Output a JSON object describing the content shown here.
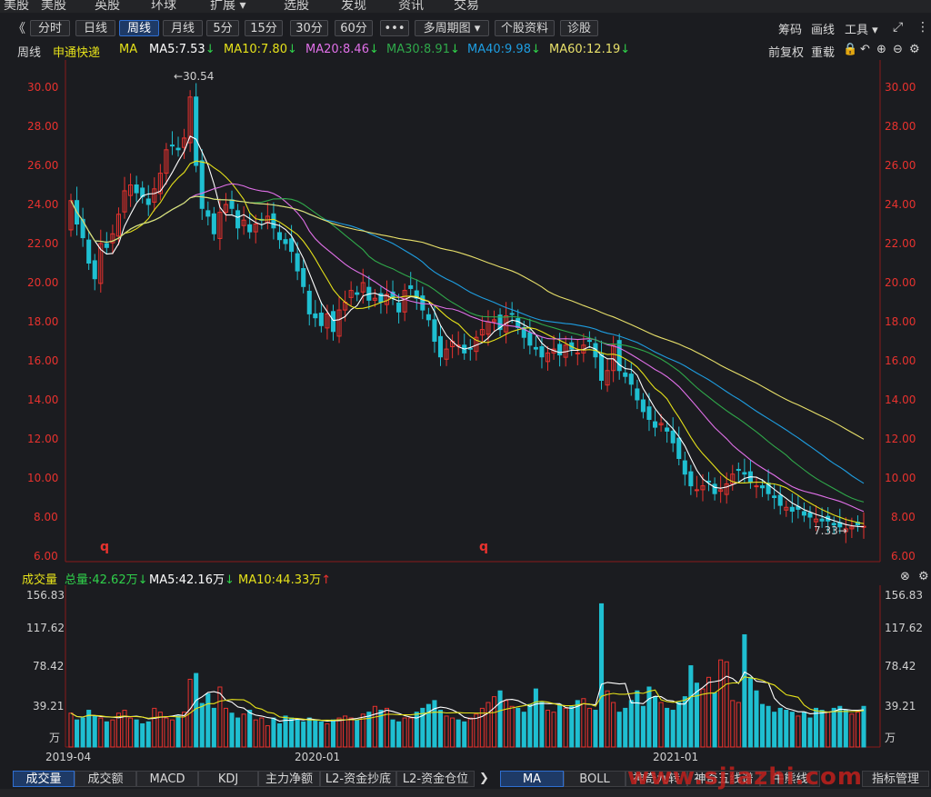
{
  "top_menu": [
    "美股",
    "英股",
    "环球",
    "扩展 ▾",
    "选股",
    "发现",
    "资讯",
    "交易"
  ],
  "toolbar": {
    "back": "《",
    "periods": [
      "分时",
      "日线",
      "周线",
      "月线",
      "5分",
      "15分",
      "30分",
      "60分",
      "•••",
      "多周期图 ▾",
      "个股资料",
      "诊股"
    ],
    "active_period": "周线",
    "right_tools": [
      "筹码",
      "画线",
      "工具 ▾"
    ]
  },
  "ma_line": {
    "period": "周线",
    "stock_name": "申通快递",
    "ma": "MA",
    "ma5": "MA5:7.53",
    "ma10": "MA10:7.80",
    "ma20": "MA20:8.46",
    "ma30": "MA30:8.91",
    "ma40": "MA40:9.98",
    "ma60": "MA60:12.19",
    "adjust": "前复权",
    "reset": "重载"
  },
  "colors": {
    "up": "#e8322e",
    "down": "#1fbfd1",
    "ma5": "#ffffff",
    "ma10": "#e5e11a",
    "ma20": "#e070e8",
    "ma30": "#2fa84a",
    "ma40": "#1e9de0",
    "ma60": "#e8e06a",
    "volume_ma5": "#ffffff",
    "volume_ma10": "#e5e11a"
  },
  "price_axis": [
    "30.00",
    "28.00",
    "26.00",
    "24.00",
    "22.00",
    "20.00",
    "18.00",
    "16.00",
    "14.00",
    "12.00",
    "10.00",
    "8.00",
    "6.00"
  ],
  "price_annotations": {
    "high": "30.54",
    "low": "7.33",
    "marker": "q"
  },
  "volume_header": {
    "label": "成交量",
    "total": "总量:42.62万",
    "ma5": "MA5:42.16万",
    "ma10": "MA10:44.33万"
  },
  "volume_axis": [
    "156.83",
    "117.62",
    "78.42",
    "39.21",
    "万"
  ],
  "date_axis": [
    "2019-04",
    "2020-01",
    "2021-01"
  ],
  "bottom_tabs_left": [
    "成交量",
    "成交额",
    "MACD",
    "KDJ",
    "主力净额",
    "L2-资金抄底",
    "L2-资金仓位"
  ],
  "bottom_tabs_right": [
    "MA",
    "BOLL",
    "神奇九转",
    "神奇五线谱",
    "牛熊线",
    "指标管理"
  ],
  "watermark": "www.sjiazhi.com",
  "chart_data": {
    "type": "candlestick",
    "title": "申通快递 周线",
    "ylim": [
      6,
      31
    ],
    "weekly_close": [
      24.2,
      23.0,
      22.3,
      21.0,
      20.2,
      22.0,
      21.8,
      22.5,
      23.5,
      24.7,
      25.0,
      24.6,
      24.4,
      24.0,
      24.8,
      25.6,
      26.8,
      27.0,
      26.8,
      27.4,
      29.5,
      26.0,
      23.8,
      23.4,
      22.5,
      23.6,
      24.0,
      23.8,
      22.8,
      23.2,
      22.6,
      23.0,
      23.2,
      23.4,
      22.8,
      22.2,
      22.0,
      21.6,
      20.6,
      19.8,
      18.4,
      18.2,
      17.8,
      18.4,
      17.5,
      18.6,
      19.0,
      19.6,
      19.4,
      20.0,
      19.1,
      19.2,
      19.0,
      19.4,
      19.2,
      18.5,
      19.6,
      19.7,
      19.2,
      18.6,
      18.1,
      17.0,
      16.2,
      16.6,
      17.0,
      16.8,
      16.4,
      16.6,
      17.2,
      17.6,
      18.0,
      18.1,
      17.6,
      18.3,
      18.4,
      17.7,
      17.2,
      16.8,
      16.6,
      16.2,
      16.4,
      16.6,
      16.3,
      16.8,
      16.6,
      16.4,
      16.8,
      17.0,
      16.2,
      15.0,
      15.5,
      16.8,
      15.5,
      15.2,
      14.8,
      14.0,
      13.4,
      13.0,
      12.6,
      12.8,
      12.4,
      11.8,
      11.0,
      10.2,
      9.6,
      9.4,
      9.6,
      9.8,
      9.2,
      9.4,
      9.7,
      10.2,
      10.4,
      10.2,
      9.8,
      9.6,
      9.5,
      9.2,
      9.0,
      8.6,
      8.5,
      8.3,
      8.4,
      8.1,
      8.0,
      7.9,
      7.8,
      7.8,
      7.6,
      7.5,
      7.4,
      7.5,
      7.6,
      7.53
    ],
    "weekly_volume": [
      35,
      28,
      30,
      38,
      32,
      30,
      26,
      28,
      35,
      38,
      30,
      28,
      24,
      26,
      40,
      36,
      30,
      28,
      32,
      36,
      70,
      76,
      45,
      55,
      40,
      62,
      40,
      35,
      30,
      34,
      38,
      28,
      30,
      22,
      30,
      24,
      32,
      30,
      28,
      26,
      30,
      28,
      26,
      24,
      28,
      30,
      32,
      30,
      28,
      34,
      36,
      42,
      38,
      40,
      28,
      26,
      30,
      30,
      36,
      40,
      44,
      48,
      38,
      32,
      30,
      28,
      26,
      30,
      34,
      40,
      46,
      52,
      58,
      48,
      42,
      40,
      36,
      44,
      60,
      46,
      38,
      36,
      44,
      40,
      42,
      48,
      50,
      40,
      38,
      148,
      58,
      46,
      36,
      40,
      48,
      58,
      42,
      62,
      52,
      46,
      40,
      38,
      46,
      52,
      84,
      66,
      60,
      72,
      56,
      90,
      88,
      48,
      46,
      116,
      72,
      58,
      44,
      42,
      36,
      40,
      38,
      36,
      32,
      36,
      30,
      40,
      38,
      36,
      40,
      42,
      38,
      34,
      36,
      42
    ],
    "ma_values": {
      "MA5": 7.53,
      "MA10": 7.8,
      "MA20": 8.46,
      "MA30": 8.91,
      "MA40": 9.98,
      "MA60": 12.19
    },
    "volume_axis_values": [
      156.83,
      117.62,
      78.42,
      39.21
    ],
    "volume_ma": {
      "MA5": 42.16,
      "MA10": 44.33,
      "total": 42.62
    },
    "x_labels": [
      "2019-04",
      "2020-01",
      "2021-01"
    ]
  }
}
